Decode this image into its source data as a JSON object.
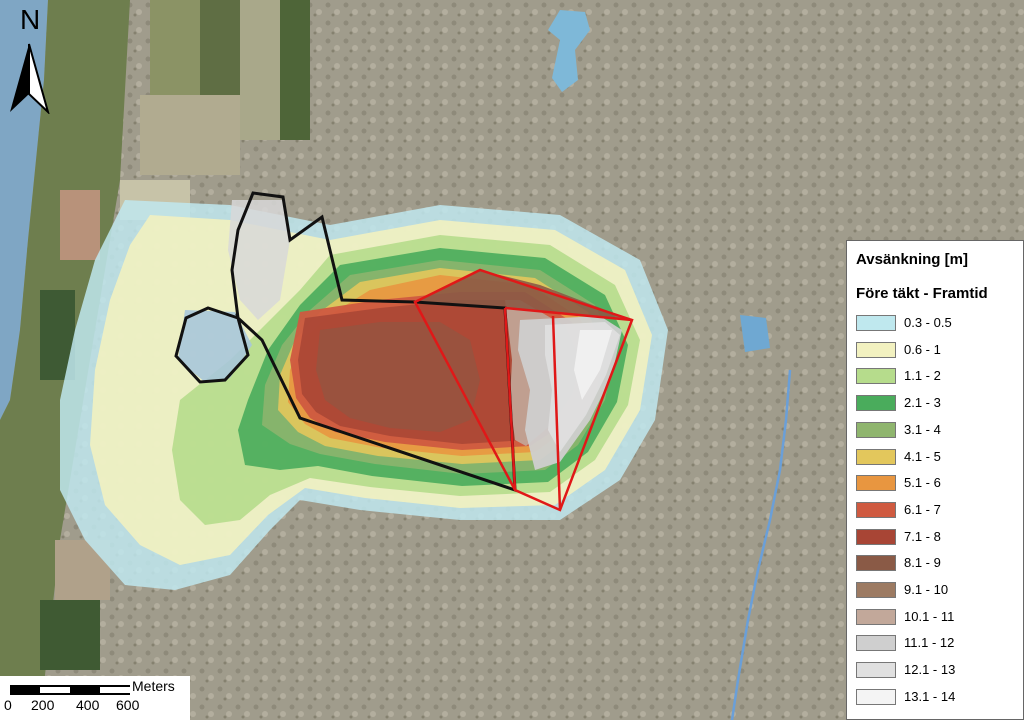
{
  "map": {
    "north_arrow_label": "N",
    "legend": {
      "title": "Avsänkning [m]",
      "subtitle": "Före täkt - Framtid",
      "classes": [
        {
          "label": "0.3 - 0.5",
          "color": "#bfe8ee"
        },
        {
          "label": "0.6 - 1",
          "color": "#f2f1c0"
        },
        {
          "label": "1.1 - 2",
          "color": "#b6dc8c"
        },
        {
          "label": "2.1 - 3",
          "color": "#4aac5c"
        },
        {
          "label": "3.1 - 4",
          "color": "#8fb56e"
        },
        {
          "label": "4.1 - 5",
          "color": "#e3c75c"
        },
        {
          "label": "5.1 - 6",
          "color": "#e89640"
        },
        {
          "label": "6.1 - 7",
          "color": "#cf5a40"
        },
        {
          "label": "7.1 - 8",
          "color": "#a84535"
        },
        {
          "label": "8.1 - 9",
          "color": "#8a5a46"
        },
        {
          "label": "9.1 - 10",
          "color": "#9c7a62"
        },
        {
          "label": "10.1 - 11",
          "color": "#c2a89a"
        },
        {
          "label": "11.1 - 12",
          "color": "#cfcfcf"
        },
        {
          "label": "12.1 - 13",
          "color": "#e0e0e0"
        },
        {
          "label": "13.1 - 14",
          "color": "#f4f4f4"
        }
      ]
    },
    "scale_bar": {
      "units": "Meters",
      "ticks": [
        "0",
        "200",
        "400",
        "600"
      ]
    },
    "colors": {
      "pit_outline": "#e01818",
      "boundary_outline": "#111111",
      "sea": "#7fa6c4",
      "watercourse": "#6a9fd8"
    }
  }
}
